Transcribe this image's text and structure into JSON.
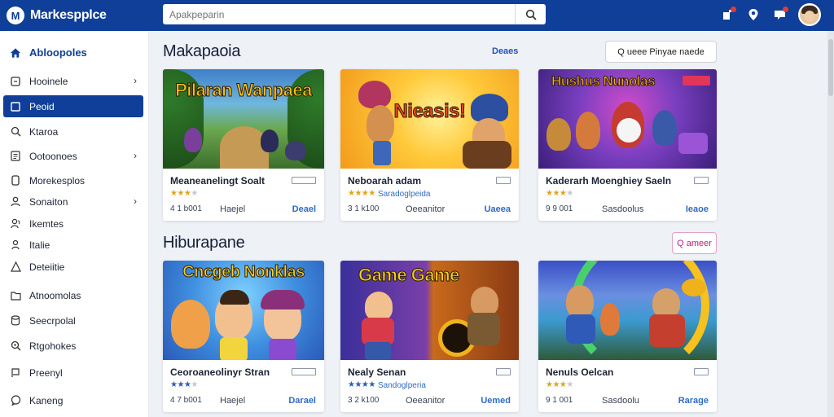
{
  "app": {
    "name": "Markespplce",
    "logo_glyph": "M"
  },
  "search": {
    "placeholder": "Apakpeparin",
    "value": ""
  },
  "topbar": {
    "icons": [
      "notification-icon",
      "location-pin-icon",
      "message-icon",
      "user-avatar"
    ],
    "accent_color": "#0f3f98",
    "alert_color": "#e53935"
  },
  "sidebar": {
    "items": [
      {
        "label": "Abloopoles",
        "icon": "home-icon",
        "chevron": false,
        "state": "home"
      },
      {
        "label": "Hooinele",
        "icon": "square-icon",
        "chevron": true,
        "state": ""
      },
      {
        "label": "Peoid",
        "icon": "square-icon",
        "chevron": false,
        "state": "active"
      },
      {
        "label": "Ktaroa",
        "icon": "search-icon",
        "chevron": false,
        "state": ""
      },
      {
        "label": "Ootoonoes",
        "icon": "list-icon",
        "chevron": true,
        "state": ""
      },
      {
        "label": "Morekesplos",
        "icon": "bookmark-icon",
        "chevron": false,
        "state": ""
      },
      {
        "label": "Sonaiton",
        "icon": "user-icon",
        "chevron": true,
        "state": ""
      },
      {
        "label": "Ikemtes",
        "icon": "people-icon",
        "chevron": false,
        "state": ""
      },
      {
        "label": "Italie",
        "icon": "person-icon",
        "chevron": false,
        "state": ""
      },
      {
        "label": "Deteiitie",
        "icon": "triangle-icon",
        "chevron": false,
        "state": ""
      },
      {
        "label": "Atnoomolas",
        "icon": "folder-icon",
        "chevron": false,
        "state": ""
      },
      {
        "label": "Seecrpolal",
        "icon": "database-icon",
        "chevron": false,
        "state": ""
      },
      {
        "label": "Rtgohokes",
        "icon": "magnifier-icon",
        "chevron": false,
        "state": ""
      },
      {
        "label": "Preenyl",
        "icon": "flag-icon",
        "chevron": false,
        "state": ""
      },
      {
        "label": "Kaneng",
        "icon": "chat-icon",
        "chevron": false,
        "state": ""
      }
    ]
  },
  "sections": [
    {
      "title": "Makapaoia",
      "link_label": "Deaes",
      "button_label": "Q ueee Pinyae naede",
      "cards": [
        {
          "art_title": "Pilaran Wanpaea",
          "name": "Meaneanelingt Soalt",
          "stars": 3,
          "genre": "",
          "meta": "4 1 b001",
          "dev": "Haejel",
          "action": "Deael",
          "theme": "jungle"
        },
        {
          "art_title": "Nieasis!",
          "name": "Neboarah adam",
          "stars": 4,
          "genre": "Saradoglpeida",
          "meta": "3 1 k100",
          "dev": "Oeeanitor",
          "action": "Uaeea",
          "theme": "sunburst"
        },
        {
          "art_title": "Hushus Nunolas",
          "name": "Kaderarh Moenghiey Saeln",
          "stars": 3,
          "genre": "",
          "meta": "9 9 001",
          "dev": "Sasdoolus",
          "action": "Ieaoe",
          "theme": "purple"
        }
      ]
    },
    {
      "title": "Hiburapane",
      "link_label": "",
      "button_label": "Q ameer",
      "cards": [
        {
          "art_title": "Cncgeb Nonklas",
          "name": "Ceoroaneolinyr Stran",
          "stars": 3,
          "genre": "",
          "meta": "4 7 b001",
          "dev": "Haejel",
          "action": "Darael",
          "theme": "kids",
          "stars_color": "blue"
        },
        {
          "art_title": "Game Game",
          "name": "Nealy Senan",
          "stars": 4,
          "genre": "Sandoglperia",
          "meta": "3 2 k100",
          "dev": "Oeeanitor",
          "action": "Uemed",
          "theme": "split",
          "stars_color": "blue"
        },
        {
          "art_title": "",
          "name": "Nenuls Oelcan",
          "stars": 3,
          "genre": "",
          "meta": "9 1 001",
          "dev": "Sasdoolu",
          "action": "Rarage",
          "theme": "rainbow"
        }
      ]
    }
  ]
}
